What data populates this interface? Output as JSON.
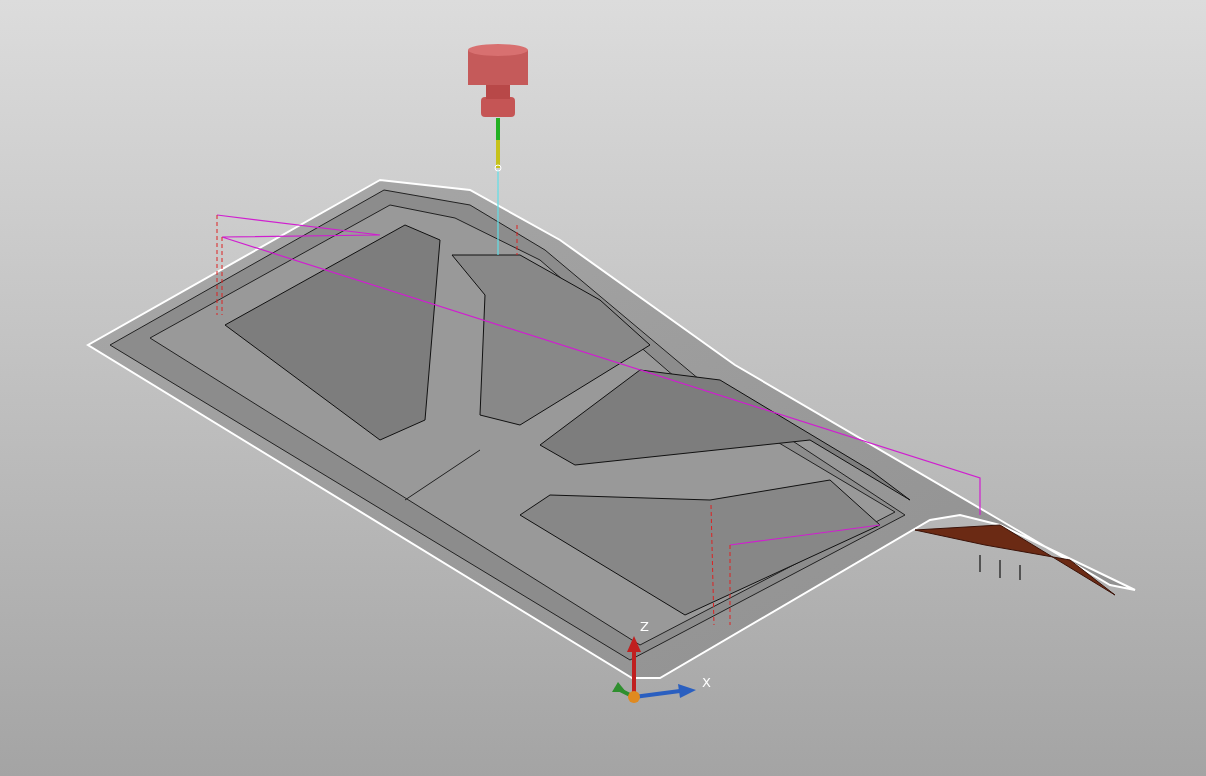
{
  "viewport": {
    "axis_labels": [
      {
        "label": "Z"
      },
      {
        "label": "X"
      }
    ]
  }
}
